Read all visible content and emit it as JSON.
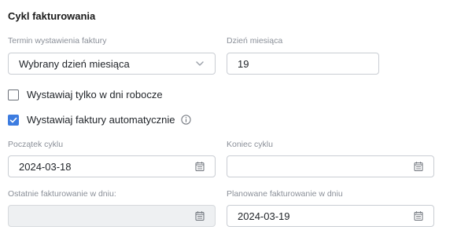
{
  "section": {
    "title": "Cykl fakturowania"
  },
  "billing_term": {
    "label": "Termin wystawienia faktury",
    "value": "Wybrany dzień miesiąca",
    "icon": "chevron-down-icon"
  },
  "day_of_month": {
    "label": "Dzień miesiąca",
    "value": "19"
  },
  "workdays_only": {
    "label": "Wystawiaj tylko w dni robocze",
    "checked": false
  },
  "auto_invoice": {
    "label": "Wystawiaj faktury automatycznie",
    "checked": true,
    "info_icon": "info-icon"
  },
  "cycle_start": {
    "label": "Początek cyklu",
    "value": "2024-03-18",
    "icon": "calendar-icon"
  },
  "cycle_end": {
    "label": "Koniec cyklu",
    "value": "",
    "icon": "calendar-icon"
  },
  "last_invoicing": {
    "label": "Ostatnie fakturowanie w dniu:",
    "value": "",
    "icon": "calendar-icon"
  },
  "planned_invoicing": {
    "label": "Planowane fakturowanie w dniu",
    "value": "2024-03-19",
    "icon": "calendar-icon"
  },
  "colors": {
    "accent": "#3d7ce0",
    "border": "#c9cdd3",
    "label": "#8a8f98",
    "disabled_bg": "#eef0f2"
  }
}
